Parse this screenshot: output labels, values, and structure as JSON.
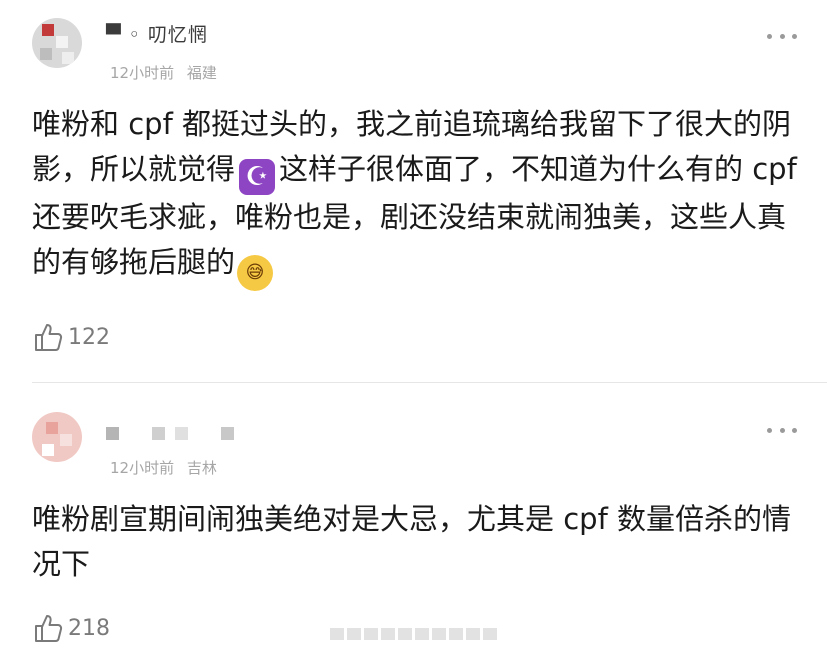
{
  "comments": [
    {
      "username": "▀ ◦ 叨忆惘",
      "time": "12小时前",
      "location": "福建",
      "text_before_moon": "唯粉和 cpf 都挺过头的，我之前追琉璃给我留下了很大的阴影，所以就觉得",
      "moon_emoji": "☪",
      "text_after_moon": "这样子很体面了，不知道为什么有的 cpf 还要吹毛求疵，唯粉也是，剧还没结束就闹独美，这些人真的有够拖后腿的",
      "face_emoji": "😅",
      "likes": "122"
    },
    {
      "username": "",
      "time": "12小时前",
      "location": "吉林",
      "text": "唯粉剧宣期间闹独美绝对是大忌，尤其是 cpf 数量倍杀的情况下",
      "likes": "218"
    }
  ],
  "icons": {
    "more": "more-dots-icon",
    "like": "thumbs-up-icon"
  },
  "colors": {
    "text": "#1a1a1a",
    "meta": "#a6a6a6",
    "like_count": "#7a7a7a",
    "moon_emoji_bg": "#8e45c4",
    "face_emoji_bg": "#f6c944"
  }
}
